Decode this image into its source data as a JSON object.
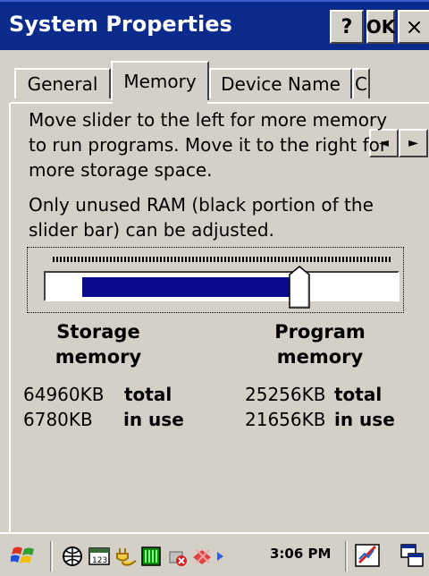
{
  "window": {
    "title": "System Properties",
    "help_label": "?",
    "ok_label": "OK",
    "close_label": "×"
  },
  "tabs": [
    {
      "label": "General",
      "active": false
    },
    {
      "label": "Memory",
      "active": true
    },
    {
      "label": "Device Name",
      "active": false
    },
    {
      "label": "C",
      "active": false
    }
  ],
  "tab_scroll": {
    "left": "◄",
    "right": "►"
  },
  "memory": {
    "instructions": "Move slider to the left for more memory to run programs. Move it to the right for more storage space.",
    "note": "Only unused RAM (black portion of the slider bar) can be adjusted.",
    "slider": {
      "storage_fraction": 0.72,
      "free_start_fraction": 0.0,
      "colors": {
        "used": "#0a0a8c",
        "free": "#ffffff"
      }
    },
    "storage": {
      "heading": "Storage memory",
      "total_value": "64960KB",
      "total_label": "total",
      "in_use_value": "6780KB",
      "in_use_label": "in use"
    },
    "program": {
      "heading": "Program memory",
      "total_value": "25256KB",
      "total_label": "total",
      "in_use_value": "21656KB",
      "in_use_label": "in use"
    }
  },
  "taskbar": {
    "clock": "3:06 PM",
    "icons": [
      "start-flag-icon",
      "network-icon",
      "keyboard-123-icon",
      "power-plug-icon",
      "battery-icon",
      "wireless-disconnected-icon",
      "remote-connection-icon",
      "tray-arrow-icon",
      "signal-blocked-icon",
      "windows-switch-icon"
    ],
    "colors": {
      "accent": "#0a2a8c",
      "surface": "#d4d0c8"
    }
  }
}
